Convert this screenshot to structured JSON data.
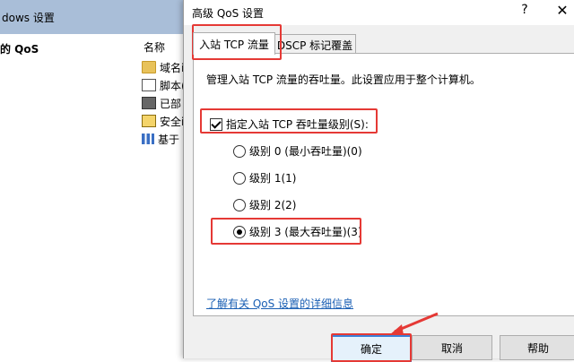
{
  "background_window": {
    "title": "dows 设置",
    "tree_item": "的 QoS",
    "column_header": "名称",
    "rows": [
      {
        "label": "域名i",
        "icon": "folder-icon"
      },
      {
        "label": "脚本(",
        "icon": "script-icon"
      },
      {
        "label": "已部",
        "icon": "printer-icon"
      },
      {
        "label": "安全i",
        "icon": "security-icon"
      },
      {
        "label": "基于",
        "icon": "chart-icon"
      }
    ]
  },
  "dialog": {
    "title": "高级 QoS 设置",
    "help_glyph": "?",
    "close_glyph": "✕",
    "tabs": [
      {
        "label": "入站 TCP 流量",
        "active": true
      },
      {
        "label": "DSCP 标记覆盖",
        "active": false
      }
    ],
    "description": "管理入站 TCP 流量的吞吐量。此设置应用于整个计算机。",
    "checkbox": {
      "label": "指定入站 TCP 吞吐量级别(S):",
      "checked": true
    },
    "radios": [
      {
        "label": "级别 0 (最小吞吐量)(0)",
        "selected": false
      },
      {
        "label": "级别 1(1)",
        "selected": false
      },
      {
        "label": "级别 2(2)",
        "selected": false
      },
      {
        "label": "级别 3 (最大吞吐量)(3)",
        "selected": true
      }
    ],
    "link": "了解有关 QoS 设置的详细信息",
    "buttons": {
      "ok": "确定",
      "cancel": "取消",
      "help": "帮助"
    }
  },
  "colors": {
    "highlight": "#e53935",
    "link": "#1a5fb4",
    "background_titlebar": "#a9bed8"
  }
}
